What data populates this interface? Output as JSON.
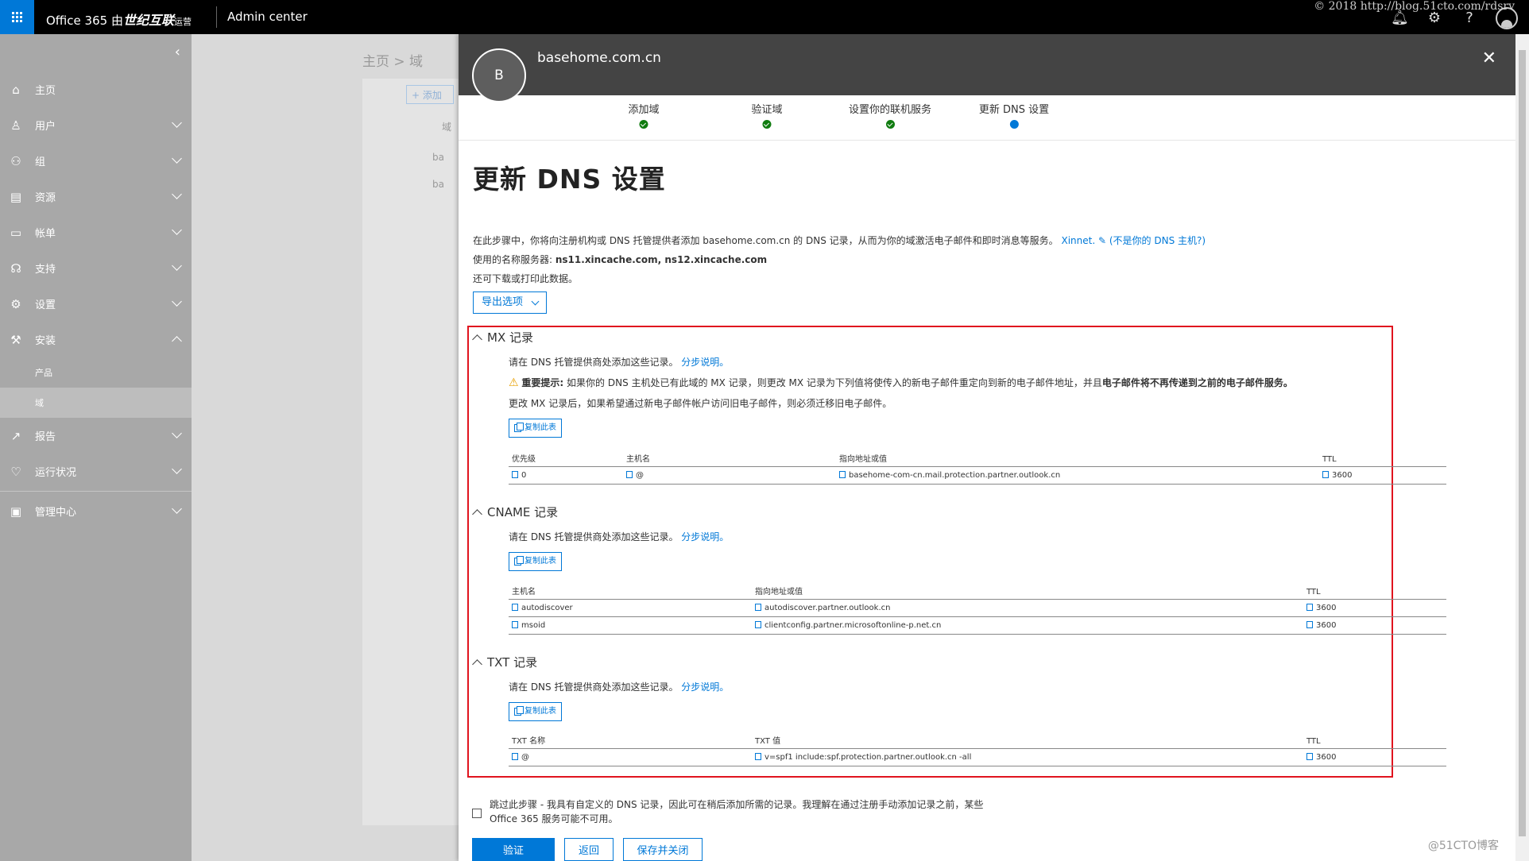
{
  "topbar": {
    "brand_prefix": "Office 365 由",
    "brand_name": "世纪互联",
    "brand_suffix": "运营",
    "admin_label": "Admin center",
    "watermark": "© 2018 http://blog.51cto.com/rdsrv"
  },
  "nav": {
    "items": [
      {
        "label": "主页",
        "icon": "home-icon"
      },
      {
        "label": "用户",
        "icon": "user-icon"
      },
      {
        "label": "组",
        "icon": "group-icon"
      },
      {
        "label": "资源",
        "icon": "resource-icon"
      },
      {
        "label": "帐单",
        "icon": "billing-icon"
      },
      {
        "label": "支持",
        "icon": "support-icon"
      },
      {
        "label": "设置",
        "icon": "gear-icon"
      },
      {
        "label": "安装",
        "icon": "wrench-icon"
      }
    ],
    "sub_items": [
      "产品",
      "域"
    ],
    "items2": [
      {
        "label": "报告",
        "icon": "chart-icon"
      },
      {
        "label": "运行状况",
        "icon": "heart-icon"
      }
    ],
    "admin_centers": "管理中心"
  },
  "background": {
    "breadcrumb": "主页 > 域",
    "add_btn": "+ 添加",
    "col": "域",
    "row1": "ba",
    "row2": "ba"
  },
  "panel": {
    "avatar_letter": "B",
    "domain": "basehome.com.cn",
    "steps": [
      "添加域",
      "验证域",
      "设置你的联机服务",
      "更新 DNS 设置"
    ],
    "title": "更新 DNS 设置",
    "intro_line1": "在此步骤中，你将向注册机构或 DNS 托管提供者添加 basehome.com.cn 的 DNS 记录，从而为你的域激活电子邮件和即时消息等服务。",
    "provider": "Xinnet.",
    "not_your_host": "(不是你的 DNS 主机?)",
    "nameservers_label": "使用的名称服务器:",
    "nameservers": "ns11.xincache.com, ns12.xincache.com",
    "download_note": "还可下载或打印此数据。",
    "export_btn": "导出选项"
  },
  "mx": {
    "heading": "MX 记录",
    "instruction": "请在 DNS 托管提供商处添加这些记录。",
    "step_link": "分步说明。",
    "warn_label": "重要提示:",
    "warn_text": "如果你的 DNS 主机处已有此域的 MX 记录，则更改 MX 记录为下列值将使传入的新电子邮件重定向到新的电子邮件地址，并且",
    "warn_bold": "电子邮件将不再传递到之前的电子邮件服务。",
    "note": "更改 MX 记录后，如果希望通过新电子邮件帐户访问旧电子邮件，则必须迁移旧电子邮件。",
    "copy_btn": "复制此表",
    "headers": [
      "优先级",
      "主机名",
      "指向地址或值",
      "TTL"
    ],
    "rows": [
      [
        "0",
        "@",
        "basehome-com-cn.mail.protection.partner.outlook.cn",
        "3600"
      ]
    ]
  },
  "cname": {
    "heading": "CNAME 记录",
    "instruction": "请在 DNS 托管提供商处添加这些记录。",
    "step_link": "分步说明。",
    "copy_btn": "复制此表",
    "headers": [
      "主机名",
      "指向地址或值",
      "TTL"
    ],
    "rows": [
      [
        "autodiscover",
        "autodiscover.partner.outlook.cn",
        "3600"
      ],
      [
        "msoid",
        "clientconfig.partner.microsoftonline-p.net.cn",
        "3600"
      ]
    ]
  },
  "txt": {
    "heading": "TXT 记录",
    "instruction": "请在 DNS 托管提供商处添加这些记录。",
    "step_link": "分步说明。",
    "copy_btn": "复制此表",
    "headers": [
      "TXT 名称",
      "TXT 值",
      "TTL"
    ],
    "rows": [
      [
        "@",
        "v=spf1 include:spf.protection.partner.outlook.cn -all",
        "3600"
      ]
    ]
  },
  "footer": {
    "skip_text": "跳过此步骤 - 我具有自定义的 DNS 记录，因此可在稍后添加所需的记录。我理解在通过注册手动添加记录之前，某些 Office 365 服务可能不可用。",
    "verify_btn": "验证",
    "back_btn": "返回",
    "save_btn": "保存并关闭",
    "watermark": "@51CTO博客"
  }
}
